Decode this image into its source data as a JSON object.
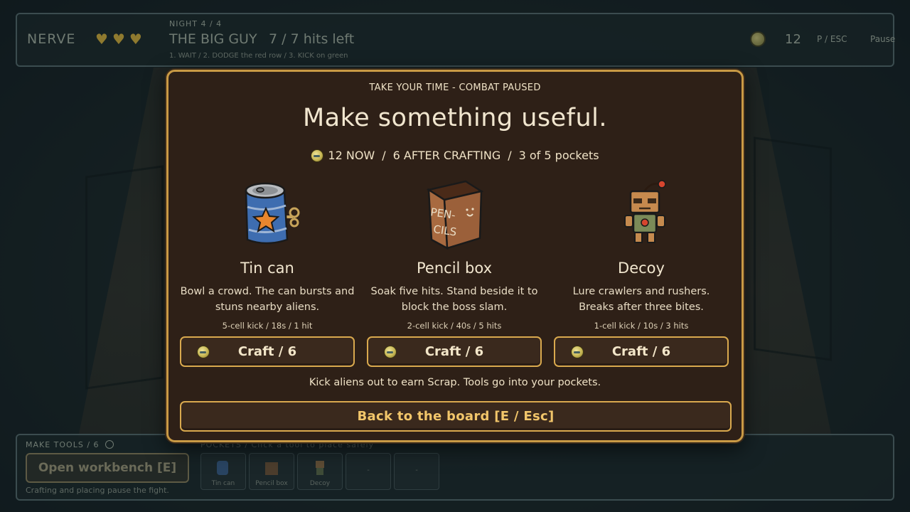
{
  "hud": {
    "nerve_label": "NERVE",
    "hearts": [
      "♥",
      "♥",
      "♥"
    ],
    "night_label": "NIGHT 4 / 4",
    "boss_name": "THE BIG GUY",
    "boss_hits": "7 / 7 hits left",
    "hint": "1. WAIT  /  2. DODGE the red row  /  3. KICK on green",
    "scrap_count": "12",
    "pause_key": "P / ESC",
    "pause_label": "Pause"
  },
  "bottom": {
    "make_tools_label": "MAKE TOOLS / 6",
    "workbench_label": "Open workbench [E]",
    "crafting_note": "Crafting and placing pause the fight.",
    "pockets_label": "POCKETS / Click a tool to place safely",
    "pockets": [
      {
        "label": "Tin can",
        "icon": "tin-can-icon"
      },
      {
        "label": "Pencil box",
        "icon": "pencil-box-icon"
      },
      {
        "label": "Decoy",
        "icon": "decoy-icon"
      },
      {
        "label": "-",
        "icon": ""
      },
      {
        "label": "-",
        "icon": ""
      }
    ]
  },
  "modal": {
    "paused_label": "TAKE YOUR TIME - COMBAT PAUSED",
    "title": "Make something useful.",
    "economy": {
      "now": "12 NOW",
      "after": "6 AFTER CRAFTING",
      "pockets": "3 of 5 pockets",
      "separator": "/"
    },
    "tools": [
      {
        "name": "Tin can",
        "icon": "tin-can-icon",
        "art_text": "",
        "desc_line1": "Bowl a crowd. The can bursts and",
        "desc_line2": "stuns nearby aliens.",
        "stats": "5-cell kick / 18s / 1 hit",
        "craft_label": "Craft / 6"
      },
      {
        "name": "Pencil box",
        "icon": "pencil-box-icon",
        "art_text_1": "PEN-",
        "art_text_2": "CILS",
        "desc_line1": "Soak five hits. Stand beside it to",
        "desc_line2": "block the boss slam.",
        "stats": "2-cell kick / 40s / 5 hits",
        "craft_label": "Craft / 6"
      },
      {
        "name": "Decoy",
        "icon": "decoy-robot-icon",
        "desc_line1": "Lure crawlers and rushers.",
        "desc_line2": "Breaks after three bites.",
        "stats": "1-cell kick / 10s / 3 hits",
        "craft_label": "Craft / 6"
      }
    ],
    "footnote": "Kick aliens out to earn Scrap. Tools go into your pockets.",
    "back_label": "Back to the board  [E / Esc]"
  },
  "colors": {
    "modal_bg": "#2e2017",
    "modal_border": "#c99a45",
    "button_border": "#d9a94e",
    "back_text": "#f2c66a",
    "backdrop": "#17262a"
  }
}
